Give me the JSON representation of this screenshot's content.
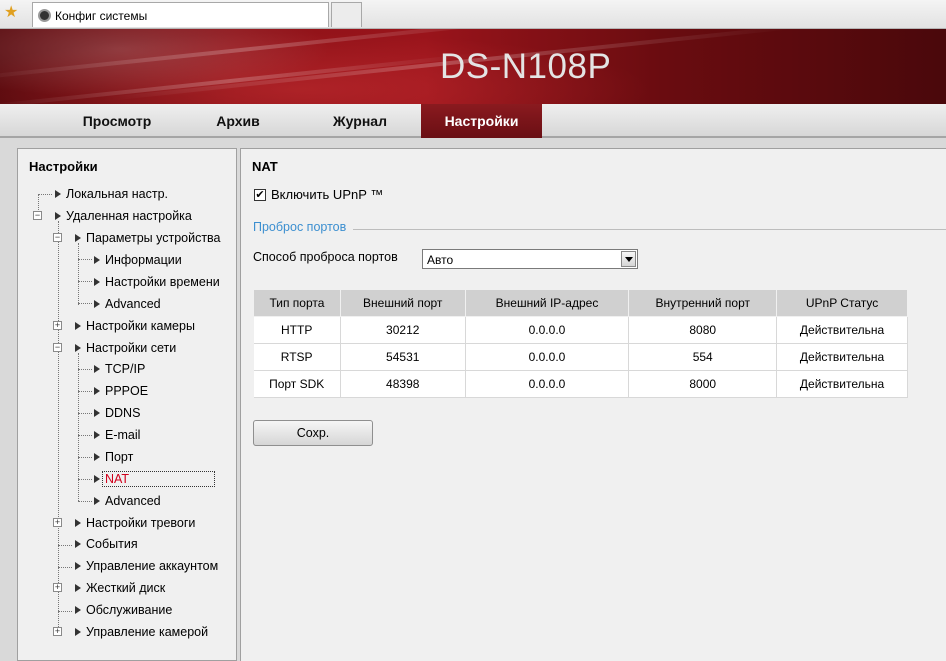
{
  "browser": {
    "tab_title": "Конфиг системы"
  },
  "header": {
    "device_name": "DS-N108P"
  },
  "nav": {
    "items": [
      {
        "label": "Просмотр"
      },
      {
        "label": "Архив"
      },
      {
        "label": "Журнал"
      },
      {
        "label": "Настройки",
        "active": true
      }
    ]
  },
  "sidebar": {
    "title": "Настройки",
    "tree": [
      {
        "label": "Локальная настр."
      },
      {
        "label": "Удаленная настройка"
      },
      {
        "label": "Параметры устройства"
      },
      {
        "label": "Информации"
      },
      {
        "label": "Настройки времени"
      },
      {
        "label": "Advanced"
      },
      {
        "label": "Настройки камеры"
      },
      {
        "label": "Настройки сети"
      },
      {
        "label": "TCP/IP"
      },
      {
        "label": "PPPOE"
      },
      {
        "label": "DDNS"
      },
      {
        "label": "E-mail"
      },
      {
        "label": "Порт"
      },
      {
        "label": "NAT",
        "selected": true
      },
      {
        "label": "Advanced"
      },
      {
        "label": "Настройки тревоги"
      },
      {
        "label": "События"
      },
      {
        "label": "Управление аккаунтом"
      },
      {
        "label": "Жесткий диск"
      },
      {
        "label": "Обслуживание"
      },
      {
        "label": "Управление камерой"
      }
    ]
  },
  "main": {
    "section_title": "NAT",
    "upnp_checkbox": {
      "label": "Включить UPnP ™",
      "checked": true,
      "mark": "✔"
    },
    "port_mapping_title": "Проброс портов",
    "mapping_mode": {
      "label": "Способ проброса портов",
      "value": "Авто"
    },
    "table": {
      "headers": [
        "Тип порта",
        "Внешний порт",
        "Внешний IP-адрес",
        "Внутренний порт",
        "UPnP Статус"
      ],
      "rows": [
        [
          "HTTP",
          "30212",
          "0.0.0.0",
          "8080",
          "Действительна"
        ],
        [
          "RTSP",
          "54531",
          "0.0.0.0",
          "554",
          "Действительна"
        ],
        [
          "Порт SDK",
          "48398",
          "0.0.0.0",
          "8000",
          "Действительна"
        ]
      ]
    },
    "save_label": "Сохр."
  }
}
